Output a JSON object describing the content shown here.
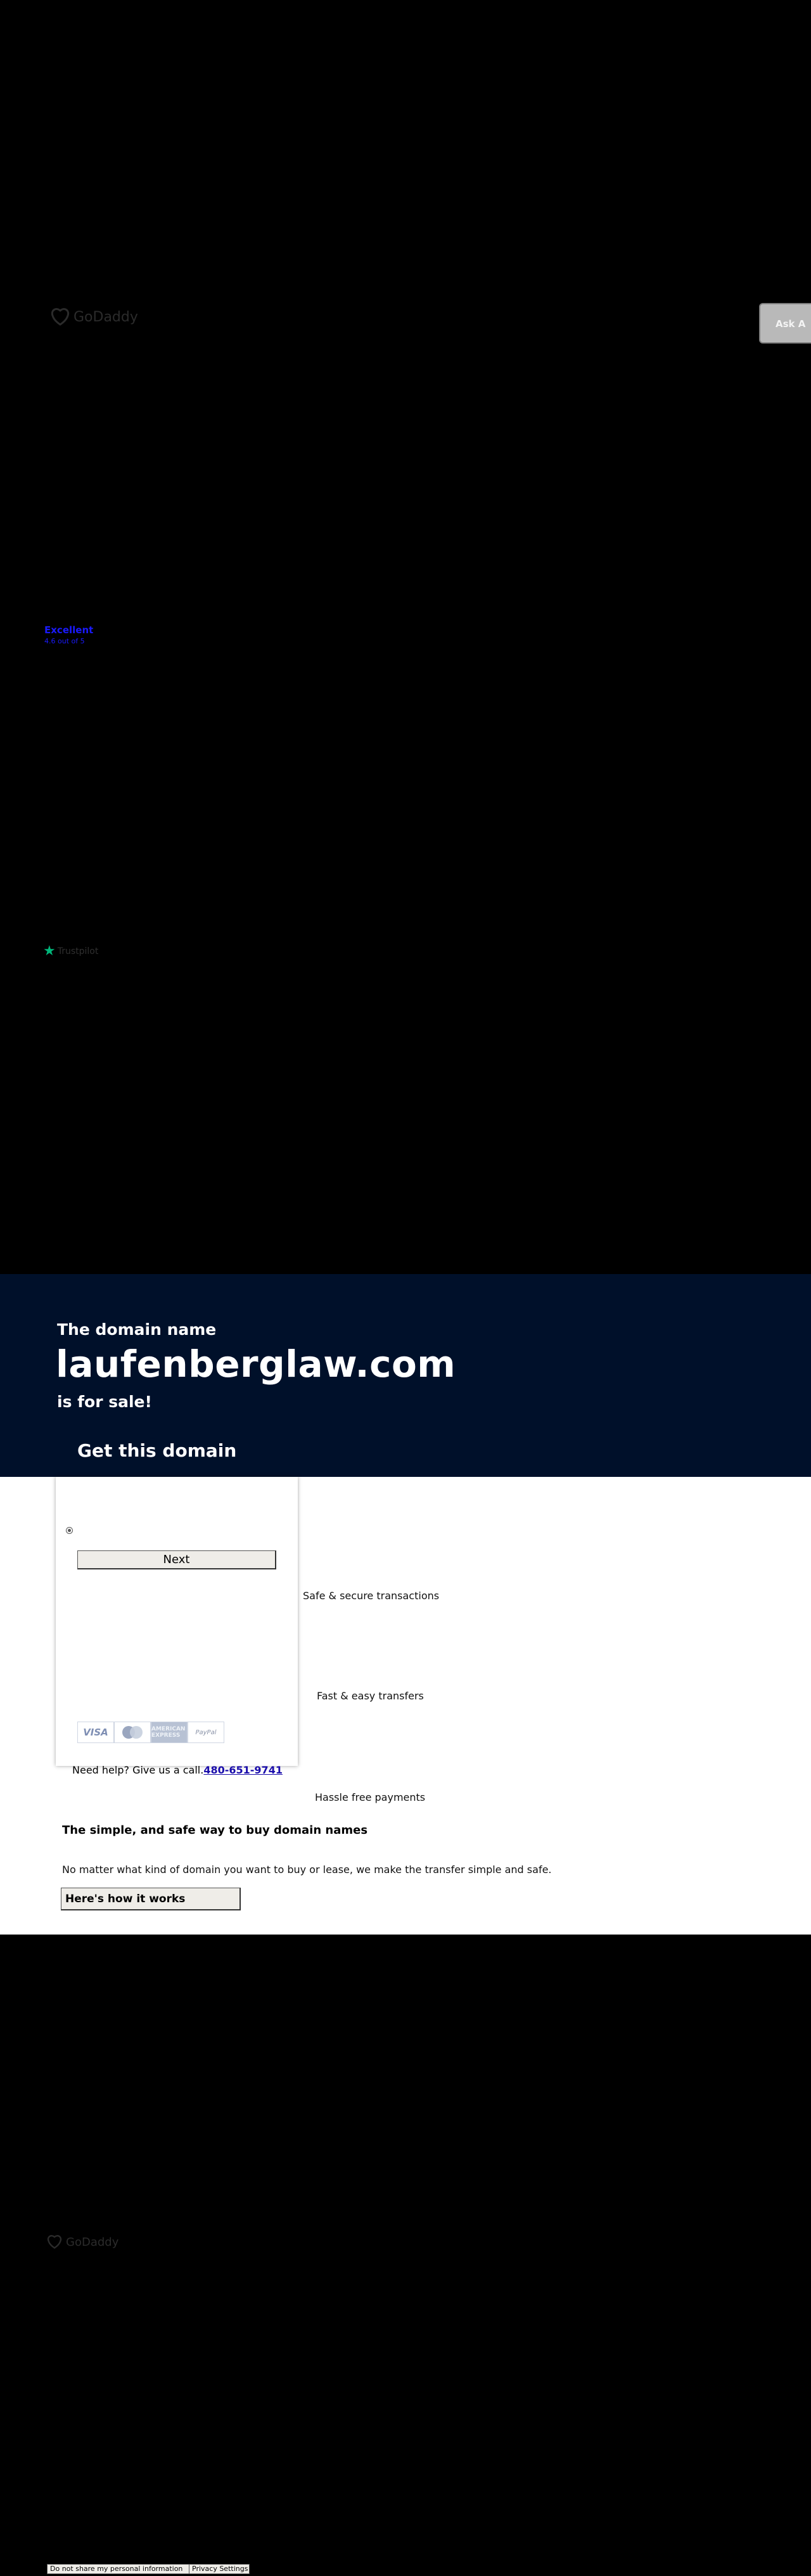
{
  "header": {
    "brand": "GoDaddy",
    "ask_button": "Ask A"
  },
  "rating": {
    "label": "Excellent",
    "score": "4.6 out of 5",
    "provider": "Trustpilot"
  },
  "hero": {
    "pre": "The domain name",
    "domain": "laufenberglaw.com",
    "post": "is for sale!",
    "cta": "Get this domain"
  },
  "purchase": {
    "next_label": "Next",
    "payments": [
      "VISA",
      "mastercard",
      "AMERICAN EXPRESS",
      "PayPal"
    ],
    "help_text": "Need help? Give us a call.",
    "phone": "480-651-9741"
  },
  "features": [
    "Safe & secure transactions",
    "Fast & easy transfers",
    "Hassle free payments"
  ],
  "info": {
    "heading": "The simple, and safe way to buy domain names",
    "body": "No matter what kind of domain you want to buy or lease, we make the transfer simple and safe.",
    "button": "Here's how it works"
  },
  "footer": {
    "brand": "GoDaddy",
    "do_not_share": "Do not share my personal information",
    "privacy": "Privacy Settings"
  },
  "colors": {
    "page_bg": "#000000",
    "hero_bg": "#00102a",
    "link": "#1a0dab",
    "rating_link": "#1a1aff",
    "trustpilot_green": "#00b67a"
  }
}
